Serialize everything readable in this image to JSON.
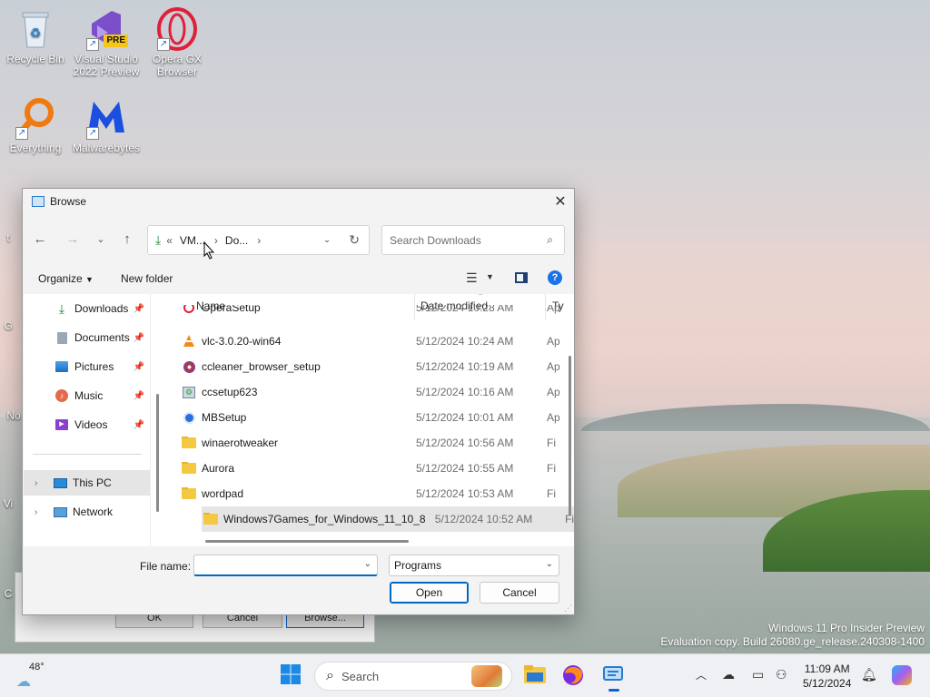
{
  "desktop": {
    "icons": [
      {
        "label": "Recycle Bin"
      },
      {
        "label": "Visual Studio 2022 Preview",
        "badge": "PRE"
      },
      {
        "label": "Opera GX Browser"
      },
      {
        "label": "Everything"
      },
      {
        "label": "Malwarebytes"
      }
    ],
    "partial_labels": [
      "t",
      "G",
      "No",
      "Vi",
      "C"
    ],
    "watermark_line1": "Windows 11 Pro Insider Preview",
    "watermark_line2": "Evaluation copy. Build 26080.ge_release.240308-1400"
  },
  "background_dialog": {
    "ok_label": "OK",
    "cancel_label": "Cancel",
    "browse_label": "Browse..."
  },
  "dialog": {
    "title": "Browse",
    "address": {
      "prefix": "«",
      "crumbs": [
        "VM...",
        "Do..."
      ]
    },
    "search_placeholder": "Search Downloads",
    "toolbar": {
      "organize": "Organize",
      "new_folder": "New folder"
    },
    "nav": {
      "quick_access": [
        {
          "label": "Downloads",
          "icon": "download-icon"
        },
        {
          "label": "Documents",
          "icon": "document-icon"
        },
        {
          "label": "Pictures",
          "icon": "pictures-icon"
        },
        {
          "label": "Music",
          "icon": "music-icon"
        },
        {
          "label": "Videos",
          "icon": "videos-icon"
        }
      ],
      "this_pc": "This PC",
      "network": "Network"
    },
    "columns": {
      "name": "Name",
      "date": "Date modified",
      "type": "Ty"
    },
    "files": [
      {
        "name": "OperaSetup",
        "date": "5/12/2024 10:28 AM",
        "type": "Ap",
        "icon": "opera-icon"
      },
      {
        "name": "vlc-3.0.20-win64",
        "date": "5/12/2024 10:24 AM",
        "type": "Ap",
        "icon": "vlc-icon"
      },
      {
        "name": "ccleaner_browser_setup",
        "date": "5/12/2024 10:19 AM",
        "type": "Ap",
        "icon": "ccleaner-browser-icon"
      },
      {
        "name": "ccsetup623",
        "date": "5/12/2024 10:16 AM",
        "type": "Ap",
        "icon": "ccleaner-icon"
      },
      {
        "name": "MBSetup",
        "date": "5/12/2024 10:01 AM",
        "type": "Ap",
        "icon": "malwarebytes-icon"
      },
      {
        "name": "winaerotweaker",
        "date": "5/12/2024 10:56 AM",
        "type": "Fi",
        "icon": "folder-icon"
      },
      {
        "name": "Aurora",
        "date": "5/12/2024 10:55 AM",
        "type": "Fi",
        "icon": "folder-icon"
      },
      {
        "name": "wordpad",
        "date": "5/12/2024 10:53 AM",
        "type": "Fi",
        "icon": "folder-icon"
      },
      {
        "name": "Windows7Games_for_Windows_11_10_8",
        "date": "5/12/2024 10:52 AM",
        "type": "Fi",
        "icon": "folder-icon",
        "selected": true
      }
    ],
    "footer": {
      "file_name_label": "File name:",
      "file_name_value": "",
      "filter_value": "Programs",
      "open_label": "Open",
      "cancel_label": "Cancel"
    }
  },
  "taskbar": {
    "weather_temp": "48°",
    "search_label": "Search",
    "time": "11:09 AM",
    "date": "5/12/2024"
  }
}
